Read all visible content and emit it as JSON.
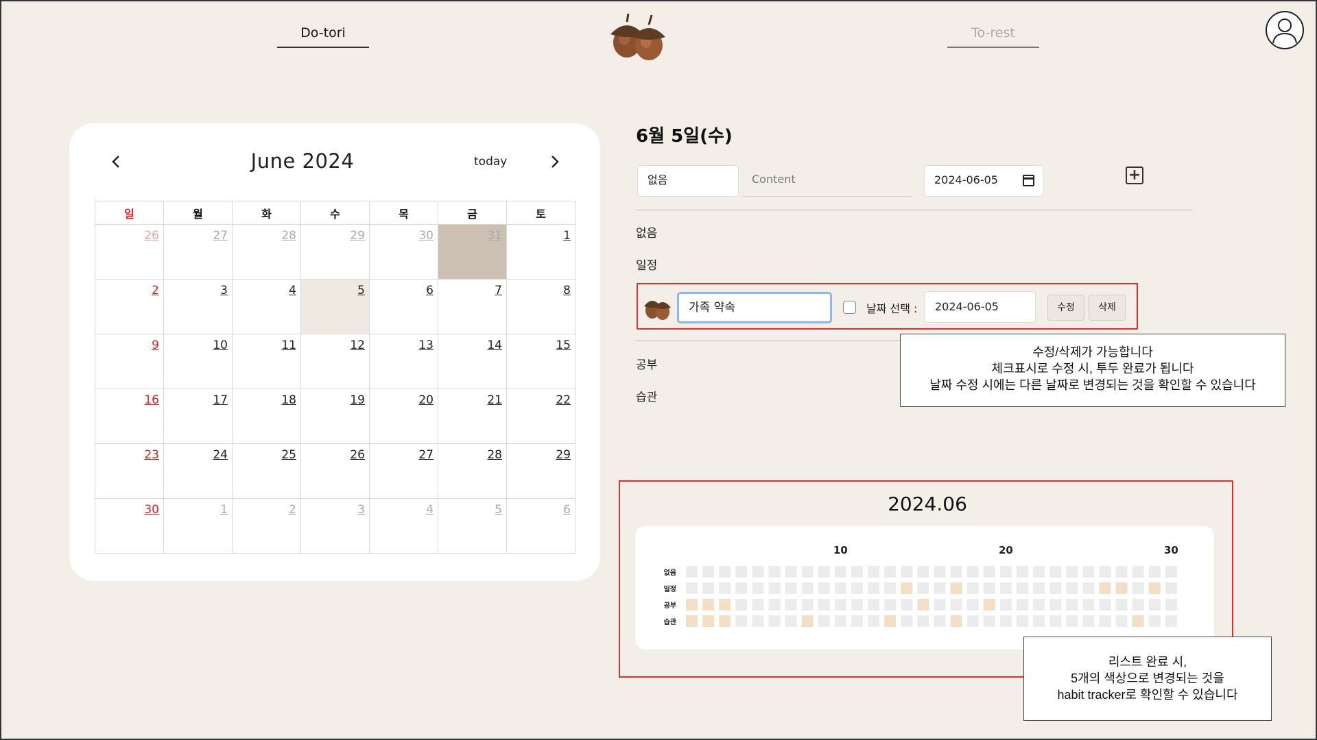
{
  "header": {
    "nav_left": "Do-tori",
    "nav_right": "To-rest",
    "logo_icon": "acorn-logo-icon",
    "profile_icon": "user-avatar-icon"
  },
  "calendar": {
    "title": "June 2024",
    "today_label": "today",
    "weekdays": [
      "일",
      "월",
      "화",
      "수",
      "목",
      "금",
      "토"
    ],
    "weeks": [
      [
        "26",
        "27",
        "28",
        "29",
        "30",
        "31",
        "1"
      ],
      [
        "2",
        "3",
        "4",
        "5",
        "6",
        "7",
        "8"
      ],
      [
        "9",
        "10",
        "11",
        "12",
        "13",
        "14",
        "15"
      ],
      [
        "16",
        "17",
        "18",
        "19",
        "20",
        "21",
        "22"
      ],
      [
        "23",
        "24",
        "25",
        "26",
        "27",
        "28",
        "29"
      ],
      [
        "30",
        "1",
        "2",
        "3",
        "4",
        "5",
        "6"
      ]
    ],
    "selected_cell": "31",
    "today_cell": "5"
  },
  "todo": {
    "date_title": "6월 5일(수)",
    "category_value": "없음",
    "content_placeholder": "Content",
    "date_value": "2024-06-05",
    "categories": [
      "없음",
      "일정",
      "공부",
      "습관"
    ],
    "edit_item": {
      "title_value": "가족 약속",
      "date_select_label": "날짜 선택 :",
      "date_value": "2024-06-05",
      "edit_label": "수정",
      "delete_label": "삭제"
    }
  },
  "notes": {
    "edit_note": [
      "수정/삭제가 가능합니다",
      "체크표시로 수정 시, 투두 완료가 됩니다",
      "날짜 수정 시에는 다른 날짜로 변경되는 것을 확인할 수 있습니다"
    ],
    "tracker_note": [
      "리스트 완료 시,",
      "5개의 색상으로 변경되는 것을",
      "habit tracker로 확인할 수 있습니다"
    ]
  },
  "tracker": {
    "title": "2024.06",
    "day_ticks": [
      "10",
      "20",
      "30"
    ],
    "rows": [
      "없음",
      "일정",
      "공부",
      "습관"
    ],
    "days": 30,
    "filled": {
      "없음": [],
      "일정": [
        14,
        17,
        26,
        27,
        29
      ],
      "공부": [
        1,
        2,
        3,
        15,
        19
      ],
      "습관": [
        1,
        2,
        3,
        8,
        13,
        17,
        28
      ]
    },
    "colors": {
      "empty": "#ecebee",
      "filled": "#f3dfc6"
    }
  },
  "colors": {
    "background": "#f3eee8",
    "highlight_border": "#e52d2d",
    "sunday": "#e02020",
    "selected_day": "#ccc0b2"
  }
}
